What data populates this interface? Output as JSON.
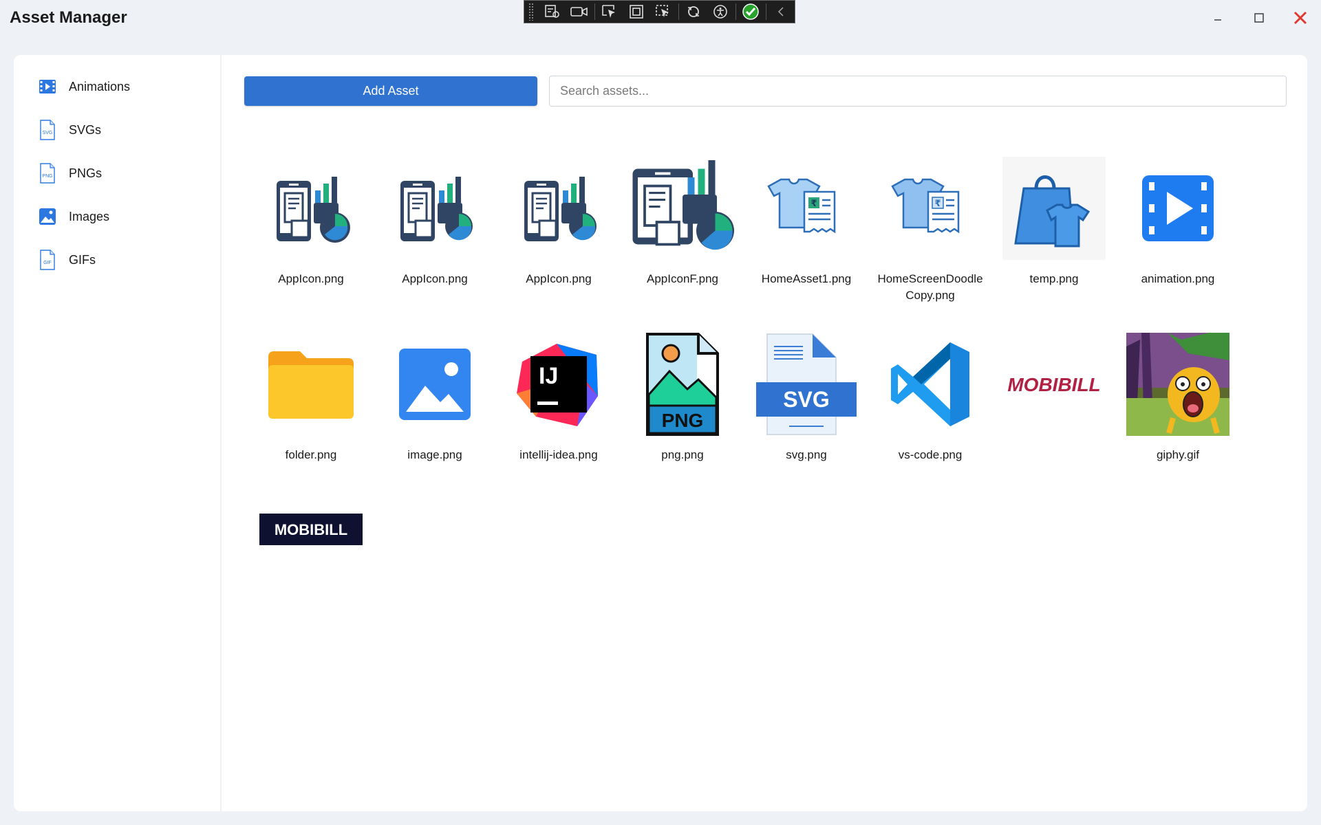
{
  "app": {
    "title": "Asset Manager"
  },
  "window": {
    "minimize": "minimize",
    "maximize": "maximize",
    "close": "close"
  },
  "sidebar": {
    "items": [
      {
        "label": "Animations",
        "icon": "film-icon"
      },
      {
        "label": "SVGs",
        "icon": "svg-file-icon"
      },
      {
        "label": "PNGs",
        "icon": "png-file-icon"
      },
      {
        "label": "Images",
        "icon": "image-icon"
      },
      {
        "label": "GIFs",
        "icon": "gif-file-icon"
      }
    ]
  },
  "toolbar": {
    "add_label": "Add Asset",
    "search_placeholder": "Search assets..."
  },
  "assets": [
    {
      "name": "AppIcon.png",
      "icon": "app-icon"
    },
    {
      "name": "AppIcon.png",
      "icon": "app-icon"
    },
    {
      "name": "AppIcon.png",
      "icon": "app-icon"
    },
    {
      "name": "AppIconF.png",
      "icon": "app-icon"
    },
    {
      "name": "HomeAsset1.png",
      "icon": "tshirt-receipt-icon"
    },
    {
      "name": "HomeScreenDoodle Copy.png",
      "icon": "tshirt-receipt-icon"
    },
    {
      "name": "temp.png",
      "icon": "shopping-bag-tshirt-icon"
    },
    {
      "name": "animation.png",
      "icon": "video-icon"
    },
    {
      "name": "folder.png",
      "icon": "folder-icon"
    },
    {
      "name": "image.png",
      "icon": "image-icon"
    },
    {
      "name": "intellij-idea.png",
      "icon": "intellij-icon"
    },
    {
      "name": "png.png",
      "icon": "png-file-icon"
    },
    {
      "name": "svg.png",
      "icon": "svg-file-icon"
    },
    {
      "name": "vs-code.png",
      "icon": "vscode-icon"
    },
    {
      "name": "",
      "icon": "mobibill-logo"
    },
    {
      "name": "giphy.gif",
      "icon": "cartoon-gif"
    },
    {
      "name": "",
      "icon": "mobibill-logo-dark"
    }
  ],
  "logos": {
    "mobibill_red": "MOBIBILL",
    "mobibill_dark": "MOBIBILL"
  },
  "thumb_text": {
    "ij": "IJ",
    "png": "PNG",
    "svg": "SVG"
  },
  "colors": {
    "accent": "#2f72d0",
    "close_red": "#e03a2f"
  }
}
